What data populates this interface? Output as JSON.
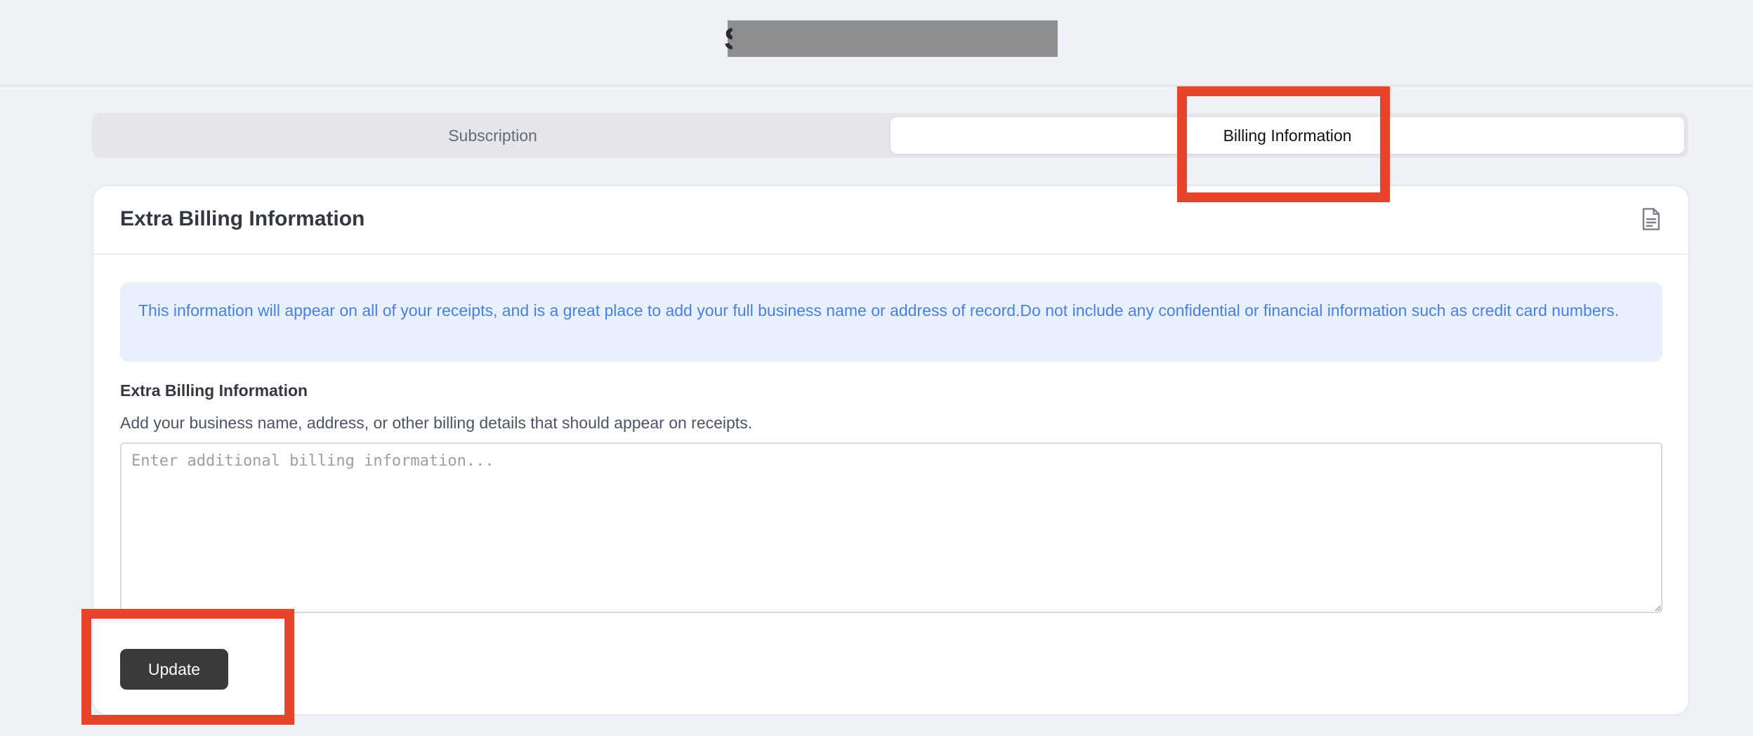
{
  "tabs": [
    {
      "label": "Subscription",
      "active": false
    },
    {
      "label": "Billing Information",
      "active": true
    }
  ],
  "card": {
    "title": "Extra Billing Information",
    "header_icon": "document-icon"
  },
  "notice": {
    "text": "This information will appear on all of your receipts, and is a great place to add your full business name or address of record.Do not include any confidential or financial information such as credit card numbers."
  },
  "field": {
    "label": "Extra Billing Information",
    "help": "Add your business name, address, or other billing details that should appear on receipts.",
    "placeholder": "Enter additional billing information...",
    "value": ""
  },
  "actions": {
    "update_label": "Update"
  },
  "colors": {
    "page_bg": "#eef1f5",
    "notice_bg": "#e9f0fd",
    "notice_text": "#4a7fe0",
    "button_bg": "#3a3a3a",
    "highlight": "#e8432b"
  }
}
